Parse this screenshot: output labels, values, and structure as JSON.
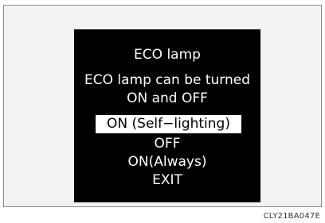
{
  "screen": {
    "title": "ECO lamp",
    "description_line1": "ECO lamp can be turned",
    "description_line2": "ON and OFF",
    "options": [
      {
        "label": "ON (Self−lighting)",
        "selected": true
      },
      {
        "label": "OFF",
        "selected": false
      },
      {
        "label": "ON(Always)",
        "selected": false
      },
      {
        "label": "EXIT",
        "selected": false
      }
    ]
  },
  "figure_code": "CLY21BA047E"
}
